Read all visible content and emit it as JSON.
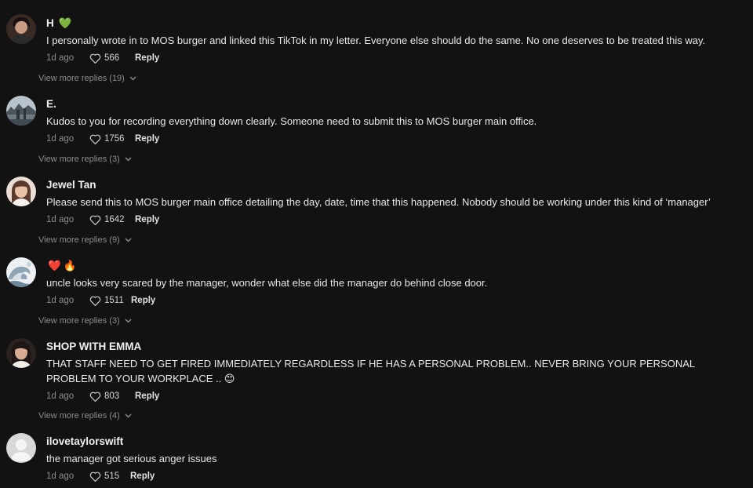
{
  "comments": [
    {
      "username": "H",
      "emoji": [
        "💚"
      ],
      "text": "I personally wrote in to MOS burger and linked this TikTok in my letter. Everyone else should do the same. No one deserves to be treated this way.",
      "time": "1d ago",
      "likes": "566",
      "reply_label": "Reply",
      "more_replies": "View more replies (19)",
      "avatar": "woman-portrait-avatar"
    },
    {
      "username": "E.",
      "emoji": [],
      "text": "Kudos to you for recording everything down clearly. Someone need to submit this to MOS burger main office.",
      "time": "1d ago",
      "likes": "1756",
      "reply_label": "Reply",
      "more_replies": "View more replies (3)",
      "avatar": "landscape-photo-avatar"
    },
    {
      "username": "Jewel Tan",
      "emoji": [],
      "text": "Please send this to MOS burger main office detailing the day, date, time that this happened. Nobody should be working under this kind of ‘manager’",
      "time": "1d ago",
      "likes": "1642",
      "reply_label": "Reply",
      "more_replies": "View more replies (9)",
      "avatar": "woman-portrait-avatar"
    },
    {
      "username": "",
      "emoji": [
        "❤️",
        "🔥"
      ],
      "text": "uncle looks very scared by the manager, wonder what else did the manager do behind close door.",
      "time": "1d ago",
      "likes": "1511",
      "reply_label": "Reply",
      "more_replies": "View more replies (3)",
      "avatar": "wave-art-avatar"
    },
    {
      "username": "SHOP WITH EMMA",
      "emoji": [],
      "text": "THAT STAFF NEED TO GET FIRED IMMEDIATELY REGARDLESS IF HE HAS A PERSONAL PROBLEM.. NEVER BRING YOUR PERSONAL PROBLEM TO YOUR WORKPLACE .. 😊",
      "time": "1d ago",
      "likes": "803",
      "reply_label": "Reply",
      "more_replies": "View more replies (4)",
      "avatar": "woman-portrait-avatar"
    },
    {
      "username": "ilovetaylorswift",
      "emoji": [],
      "text": "the manager got serious anger issues",
      "time": "1d ago",
      "likes": "515",
      "reply_label": "Reply",
      "more_replies": "",
      "avatar": "default-user-avatar"
    }
  ],
  "colors": {
    "background": "#121212",
    "primary_text": "#f1f1f2",
    "secondary_text": "#8a8b91"
  }
}
